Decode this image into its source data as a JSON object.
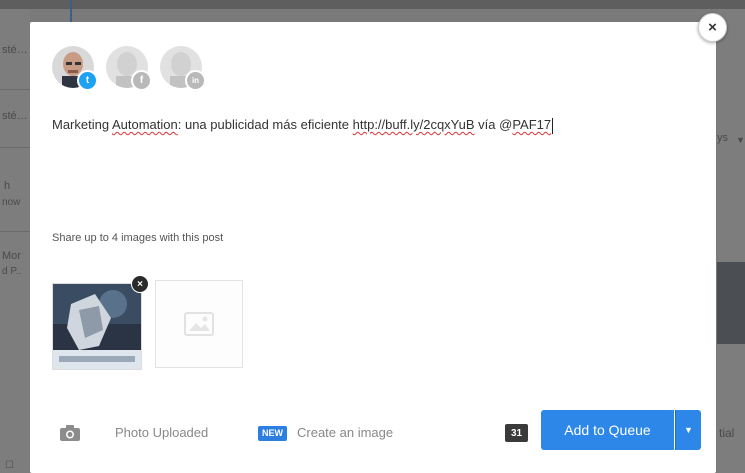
{
  "background": {
    "fragments": [
      {
        "text": "sté…",
        "name": "bg-fragment-1"
      },
      {
        "text": "sté…",
        "name": "bg-fragment-2"
      },
      {
        "text": "h",
        "name": "bg-fragment-3"
      },
      {
        "text": "now",
        "name": "bg-fragment-4"
      },
      {
        "text": "Mor",
        "name": "bg-fragment-5"
      },
      {
        "text": "d P..",
        "name": "bg-fragment-6"
      },
      {
        "text": "ys",
        "name": "bg-fragment-7"
      },
      {
        "text": "tial",
        "name": "bg-fragment-8"
      }
    ]
  },
  "composer": {
    "close_label": "×",
    "profiles": [
      {
        "network": "twitter",
        "badge": "t",
        "selected": true
      },
      {
        "network": "facebook",
        "badge": "f",
        "selected": false
      },
      {
        "network": "linkedin",
        "badge": "in",
        "selected": false
      }
    ],
    "post": {
      "prefix": "Marketing ",
      "spell1": "Automation",
      "middle": ": una publicidad más eficiente ",
      "link": "http://buff.ly/2cqxYuB",
      "via": " vía @",
      "spell2": "PAF17"
    },
    "share_label": "Share up to 4 images with this post",
    "thumb_remove": "×",
    "footer": {
      "photo_uploaded": "Photo Uploaded",
      "new_badge": "NEW",
      "create_image": "Create an image",
      "char_count": "31",
      "add_to_queue": "Add to Queue"
    },
    "colors": {
      "accent": "#2c87e8",
      "twitter": "#1da1f2",
      "disabled_badge": "#b9b9b9"
    }
  }
}
